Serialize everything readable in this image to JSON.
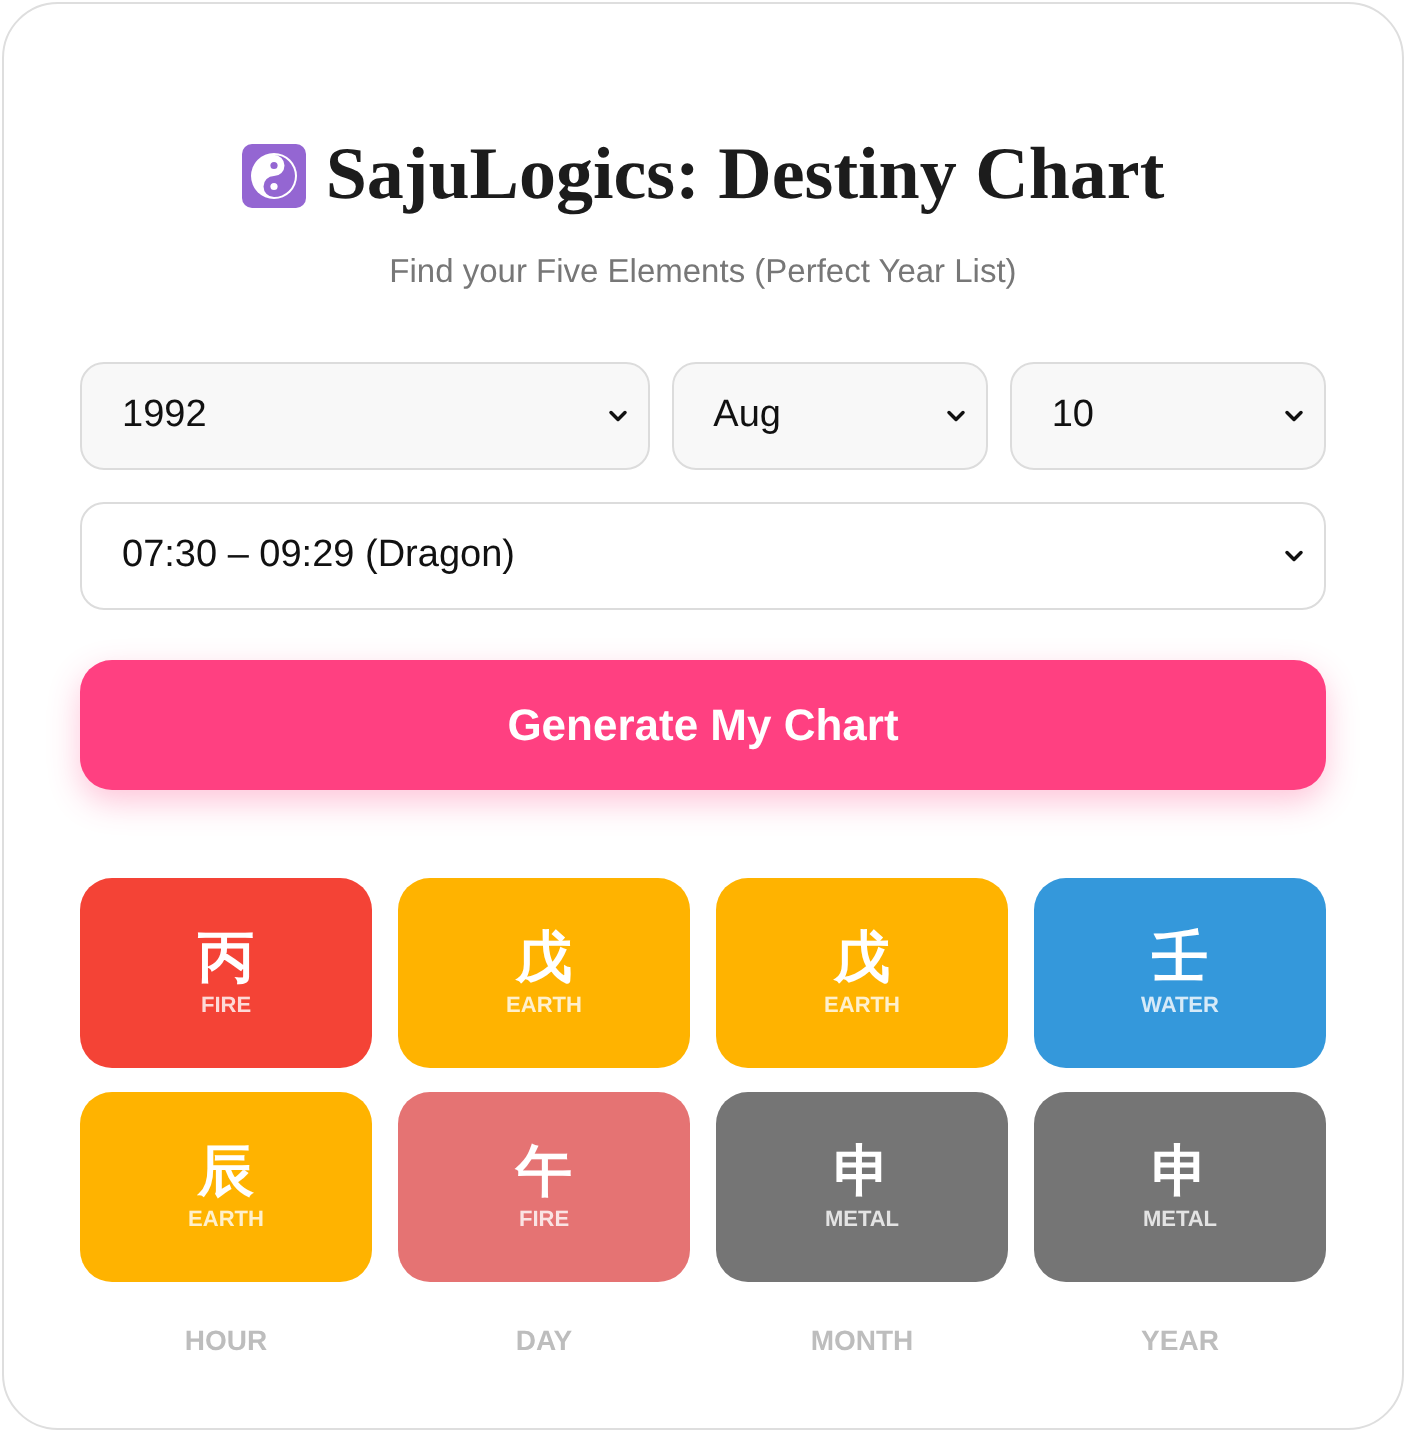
{
  "header": {
    "title": "SajuLogics: Destiny Chart",
    "subtitle": "Find your Five Elements (Perfect Year List)"
  },
  "birth_date": {
    "year": "1992",
    "month": "Aug",
    "day": "10"
  },
  "birth_time": "07:30 – 09:29 (Dragon)",
  "generate_button": "Generate My Chart",
  "chart": {
    "stems": [
      {
        "char": "丙",
        "element": "FIRE",
        "color": "#f44336"
      },
      {
        "char": "戊",
        "element": "EARTH",
        "color": "#ffb300"
      },
      {
        "char": "戊",
        "element": "EARTH",
        "color": "#ffb300"
      },
      {
        "char": "壬",
        "element": "WATER",
        "color": "#3498db"
      }
    ],
    "branches": [
      {
        "char": "辰",
        "element": "EARTH",
        "color": "#ffb300"
      },
      {
        "char": "午",
        "element": "FIRE",
        "color": "#e57373"
      },
      {
        "char": "申",
        "element": "METAL",
        "color": "#757575"
      },
      {
        "char": "申",
        "element": "METAL",
        "color": "#757575"
      }
    ],
    "pillar_labels": [
      "HOUR",
      "DAY",
      "MONTH",
      "YEAR"
    ]
  }
}
